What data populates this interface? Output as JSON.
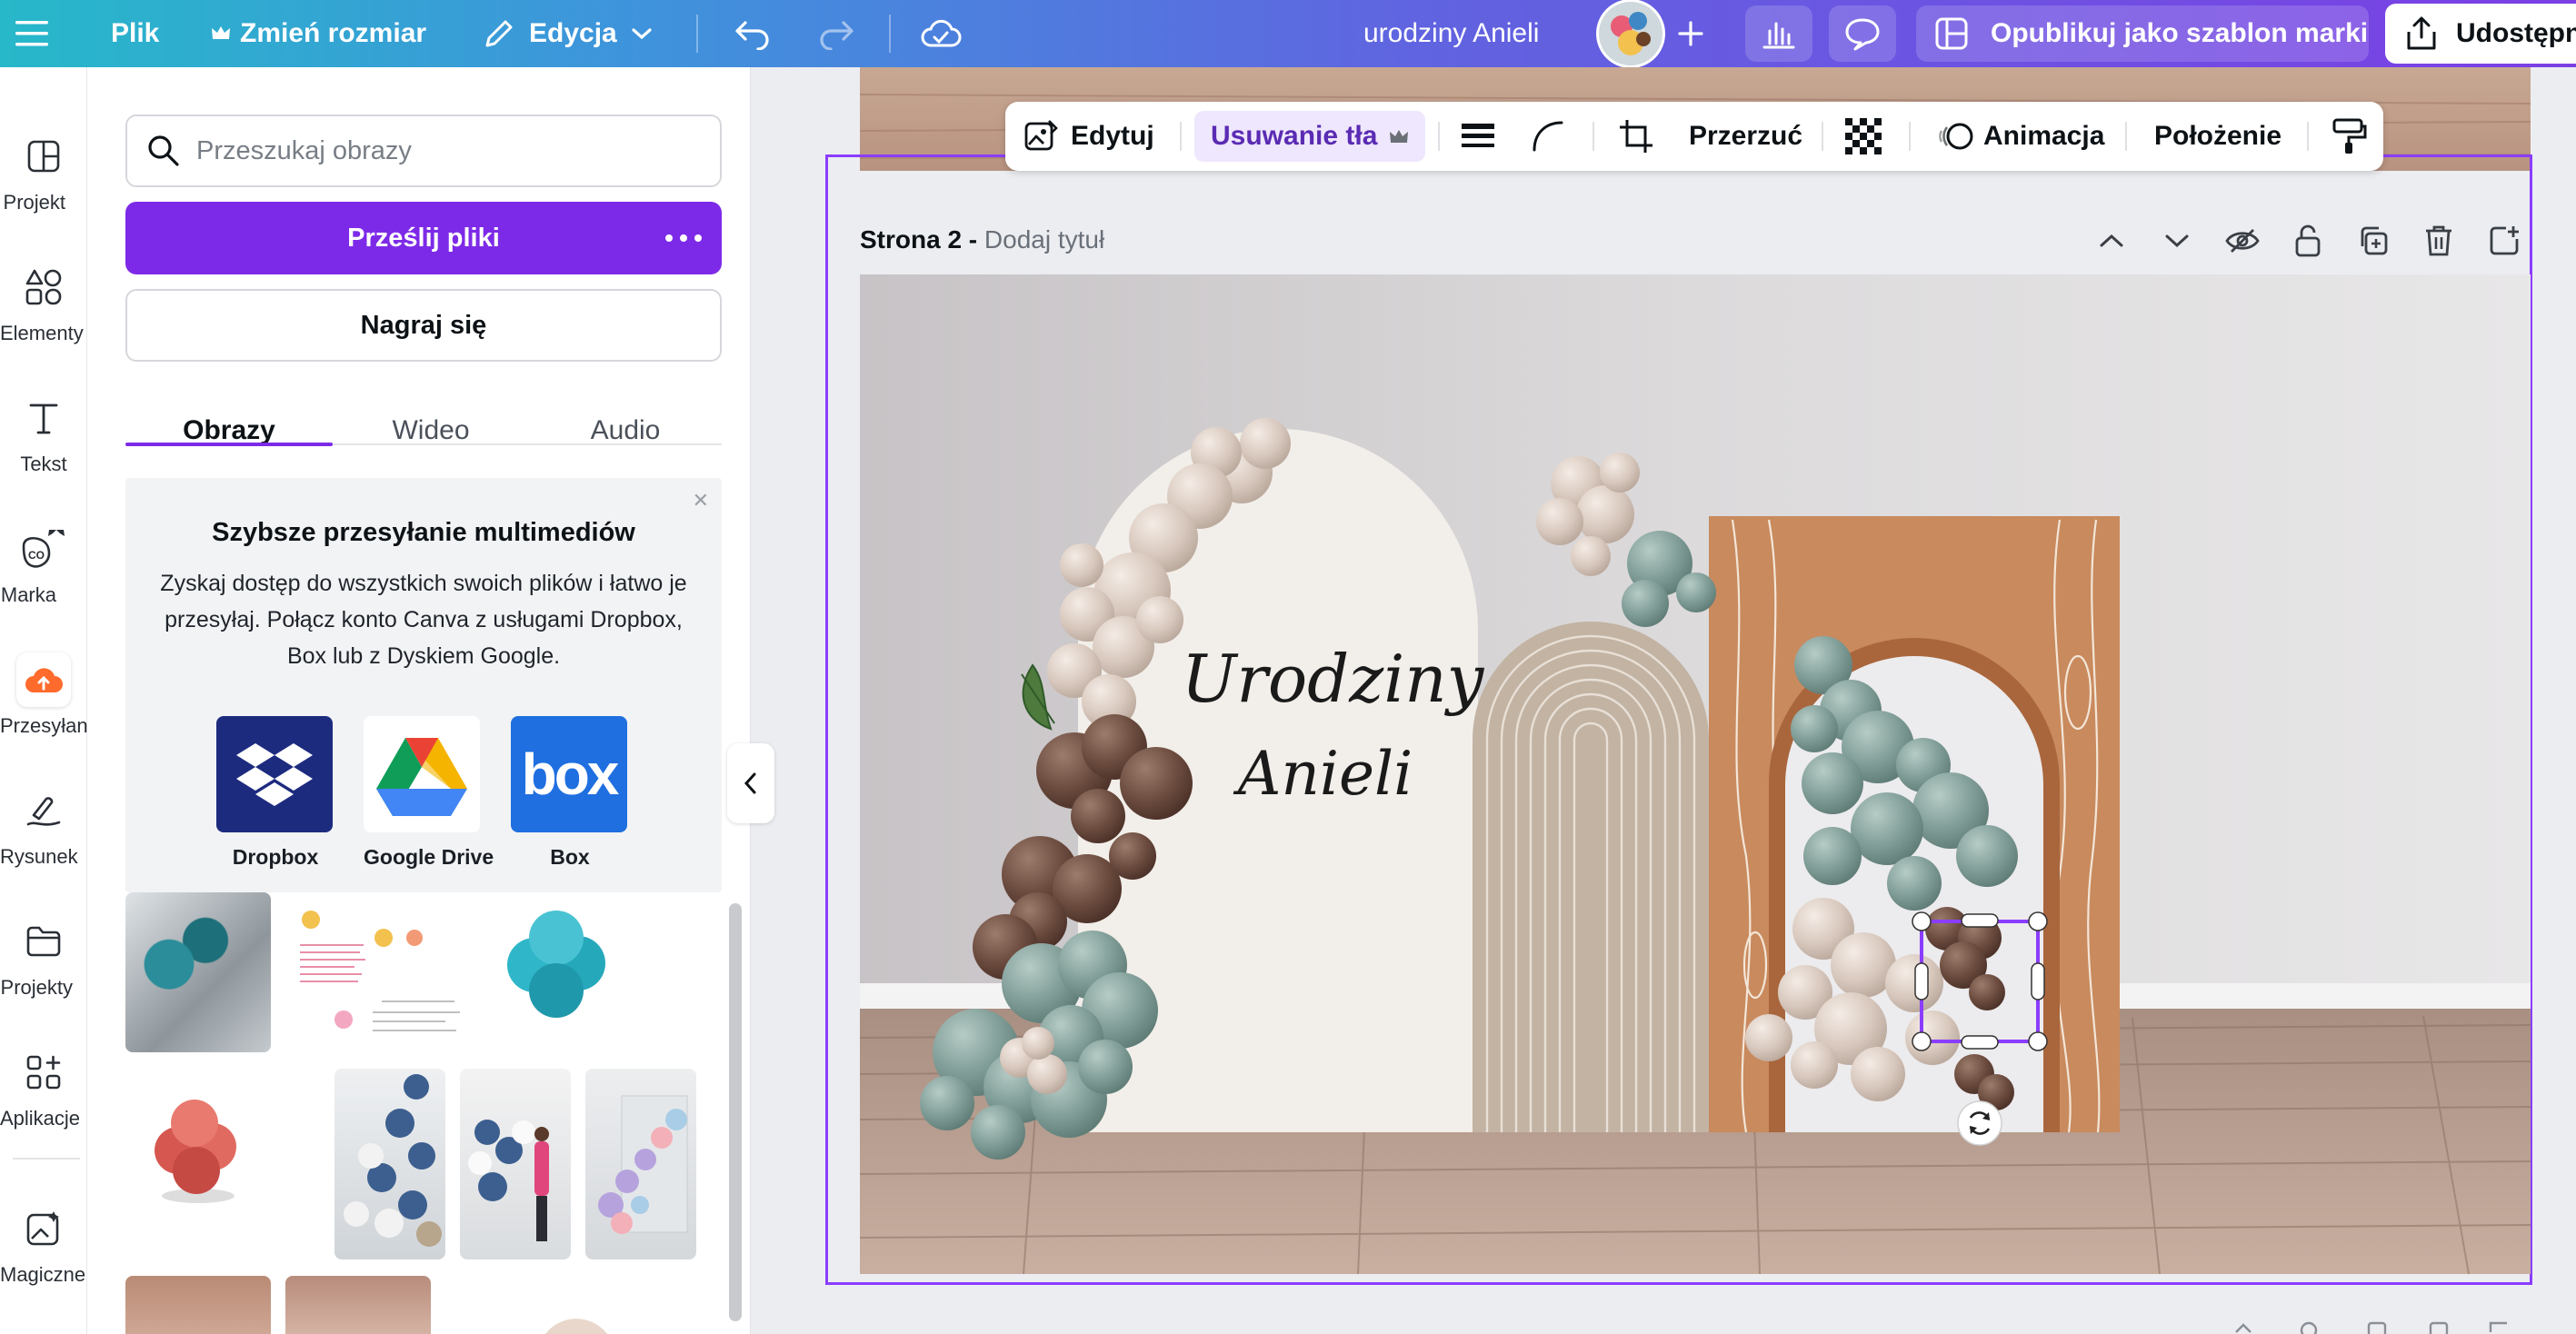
{
  "topbar": {
    "menu_icon": "hamburger-icon",
    "file_label": "Plik",
    "resize_label": "Zmień rozmiar",
    "edit_label": "Edycja",
    "doc_title": "urodziny Anieli",
    "publish_label": "Opublikuj jako szablon marki",
    "share_label": "Udostępnij"
  },
  "rail": {
    "items": [
      {
        "label": "Projekt",
        "icon": "layout-icon"
      },
      {
        "label": "Elementy",
        "icon": "shapes-icon"
      },
      {
        "label": "Tekst",
        "icon": "text-icon"
      },
      {
        "label": "Marka",
        "icon": "brand-icon"
      },
      {
        "label": "Przesyłanie",
        "icon": "upload-cloud-icon"
      },
      {
        "label": "Rysunek",
        "icon": "draw-icon"
      },
      {
        "label": "Projekty",
        "icon": "folder-icon"
      },
      {
        "label": "Aplikacje",
        "icon": "apps-icon"
      },
      {
        "label": "Magiczne m...",
        "icon": "magic-media-icon"
      }
    ]
  },
  "panel": {
    "search_placeholder": "Przeszukaj obrazy",
    "upload_label": "Prześlij pliki",
    "record_label": "Nagraj się",
    "tabs": [
      {
        "label": "Obrazy"
      },
      {
        "label": "Wideo"
      },
      {
        "label": "Audio"
      }
    ],
    "promo": {
      "title": "Szybsze przesyłanie multimediów",
      "description": "Zyskaj dostęp do wszystkich swoich plików i łatwo je przesyłaj. Połącz konto Canva z usługami Dropbox, Box lub z Dyskiem Google.",
      "services": [
        {
          "name": "Dropbox"
        },
        {
          "name": "Google Drive"
        },
        {
          "name": "Box"
        }
      ]
    },
    "box_logo_text": "box"
  },
  "context_toolbar": {
    "edit_label": "Edytuj",
    "bg_remove_label": "Usuwanie tła",
    "flip_label": "Przerzuć",
    "animate_label": "Animacja",
    "position_label": "Położenie"
  },
  "page": {
    "label": "Strona 2 -",
    "add_title": "Dodaj tytuł"
  },
  "design": {
    "text_line1": "Urodziny",
    "text_line2": "Anieli"
  },
  "colors": {
    "accent": "#7d2ae8",
    "selection": "#8b3dff",
    "dropbox": "#1d2b7f",
    "box": "#1f6fe0"
  }
}
